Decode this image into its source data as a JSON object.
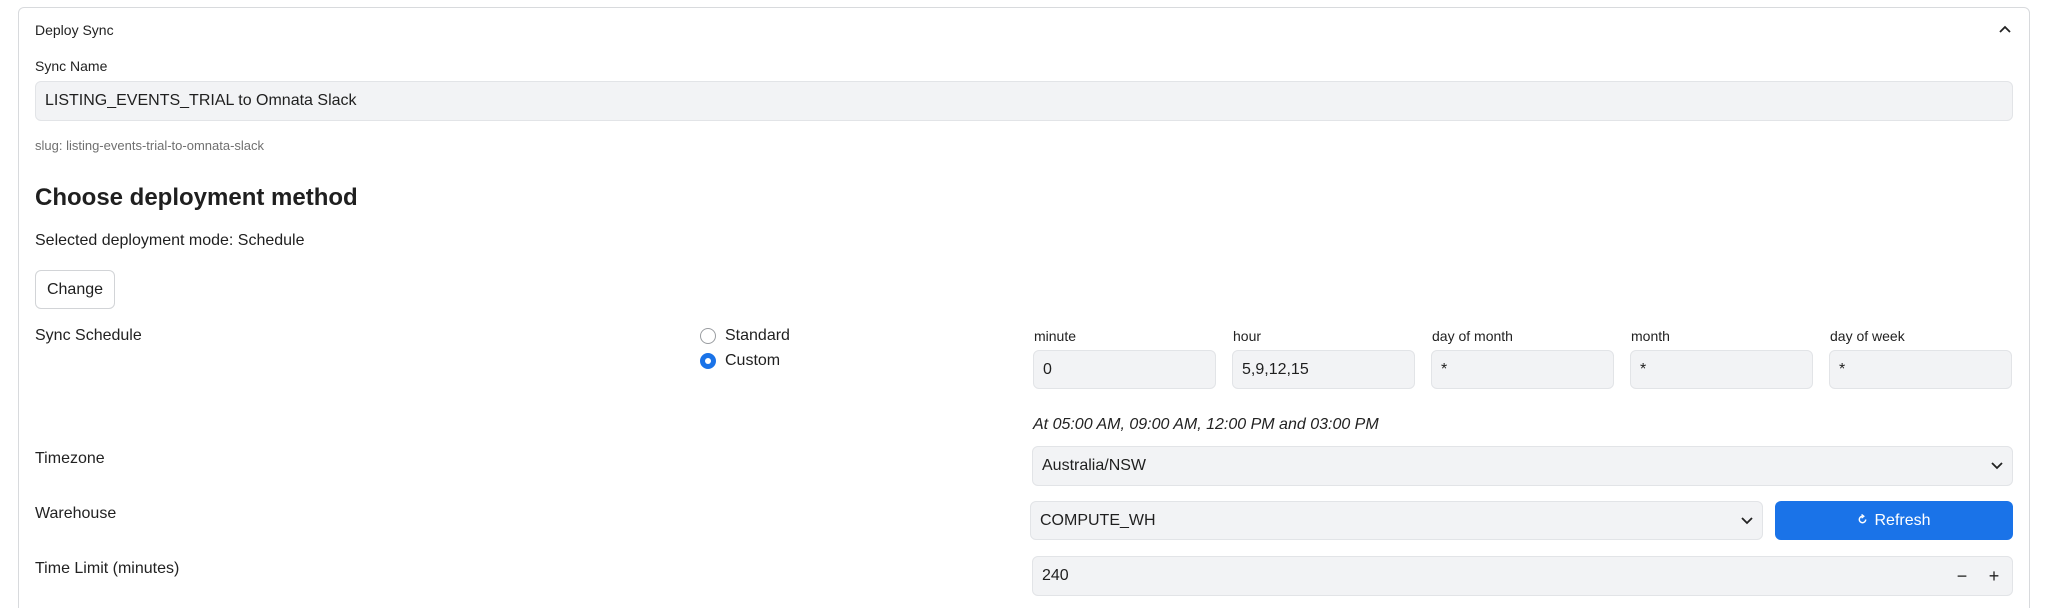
{
  "panel": {
    "title": "Deploy Sync"
  },
  "sync_name": {
    "label": "Sync Name",
    "value": "LISTING_EVENTS_TRIAL to Omnata Slack"
  },
  "slug": "slug: listing-events-trial-to-omnata-slack",
  "deployment": {
    "heading": "Choose deployment method",
    "mode_text": "Selected deployment mode: Schedule",
    "change_label": "Change"
  },
  "schedule": {
    "label": "Sync Schedule",
    "options": [
      {
        "label": "Standard",
        "selected": false
      },
      {
        "label": "Custom",
        "selected": true
      }
    ],
    "cron": {
      "minute": {
        "label": "minute",
        "value": "0"
      },
      "hour": {
        "label": "hour",
        "value": "5,9,12,15"
      },
      "day_of_month": {
        "label": "day of month",
        "value": "*"
      },
      "month": {
        "label": "month",
        "value": "*"
      },
      "day_of_week": {
        "label": "day of week",
        "value": "*"
      }
    },
    "description": "At 05:00 AM, 09:00 AM, 12:00 PM and 03:00 PM"
  },
  "timezone": {
    "label": "Timezone",
    "value": "Australia/NSW"
  },
  "warehouse": {
    "label": "Warehouse",
    "value": "COMPUTE_WH",
    "refresh_label": "Refresh"
  },
  "time_limit": {
    "label": "Time Limit (minutes)",
    "value": "240",
    "minus": "−",
    "plus": "+"
  }
}
